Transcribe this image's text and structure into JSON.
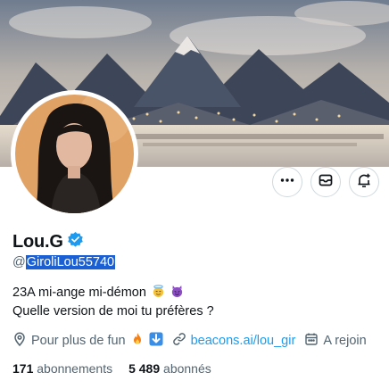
{
  "profile": {
    "display_name": "Lou.G",
    "handle_prefix": "@",
    "handle_selected": "GiroliLou55740",
    "bio_line1": "23A mi-ange mi-démon",
    "bio_line2": "Quelle version de moi tu préfères ?",
    "location": "Pour plus de fun",
    "link": "beacons.ai/lou_gir",
    "joined": "A rejoin",
    "following_count": "171",
    "following_label": "abonnements",
    "followers_count": "5 489",
    "followers_label": "abonnés"
  },
  "actions": {
    "more_icon": "more-icon",
    "message_icon": "envelope-icon",
    "notify_icon": "bell-plus-icon"
  },
  "colors": {
    "accent": "#1d9bf0",
    "selection": "#1a5fd4",
    "verified": "#1d9bf0",
    "muted": "#536471"
  }
}
